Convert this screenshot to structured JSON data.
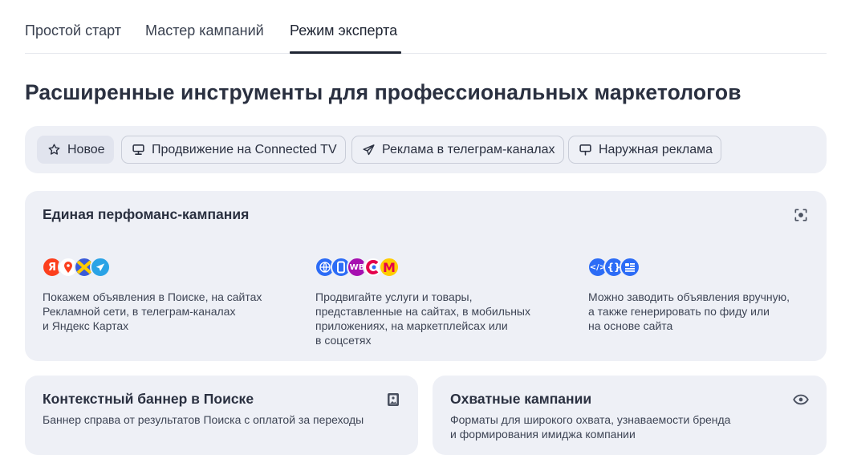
{
  "tabs": [
    {
      "label": "Простой старт"
    },
    {
      "label": "Мастер кампаний"
    },
    {
      "label": "Режим эксперта",
      "active": true
    }
  ],
  "page_title": "Расширенные инструменты для профессиональных маркетологов",
  "chips": [
    {
      "label": "Новое",
      "icon": "star-icon",
      "selected": true
    },
    {
      "label": "Продвижение на Connected TV",
      "icon": "tv-icon"
    },
    {
      "label": "Реклама в телеграм-каналах",
      "icon": "telegram-icon"
    },
    {
      "label": "Наружная реклама",
      "icon": "billboard-icon"
    }
  ],
  "performance_card": {
    "title": "Единая перфоманс-кампания",
    "icon": "focus-scan-icon",
    "columns": [
      {
        "logos": [
          "yandex-logo",
          "yandex-maps-logo",
          "yandex-network-logo",
          "telegram-logo"
        ],
        "text": "Покажем объявления в Поиске, на сайтах\nРекламной сети, в телеграм-каналах\nи Яндекс Картах"
      },
      {
        "logos": [
          "website-logo",
          "mobile-app-logo",
          "wildberries-logo",
          "ozon-logo",
          "yandex-market-logo"
        ],
        "text": "Продвигайте услуги и товары,\nпредставленные на сайтах, в мобильных\nприложениях, на маркетплейсах или\nв соцсетях"
      },
      {
        "logos": [
          "code-logo",
          "feed-logo",
          "document-logo"
        ],
        "text": "Можно заводить объявления вручную,\nа также генерировать по фиду или\nна основе сайта"
      }
    ]
  },
  "context_banner_card": {
    "title": "Контекстный баннер в Поиске",
    "icon": "image-icon",
    "description": "Баннер справа от результатов Поиска с оплатой за переходы"
  },
  "reach_card": {
    "title": "Охватные кампании",
    "icon": "eye-icon",
    "description": "Форматы для широкого охвата, узнаваемости бренда\nи формирования имиджа компании"
  },
  "colors": {
    "card_background": "#eef0f6",
    "text": "#2a3040",
    "yandex_red": "#fc3f1d",
    "telegram_blue": "#2aa3e6",
    "accent_blue": "#2c6cf6",
    "wildberries_purple": "#a60fb0",
    "market_yellow": "#ffcc00"
  }
}
